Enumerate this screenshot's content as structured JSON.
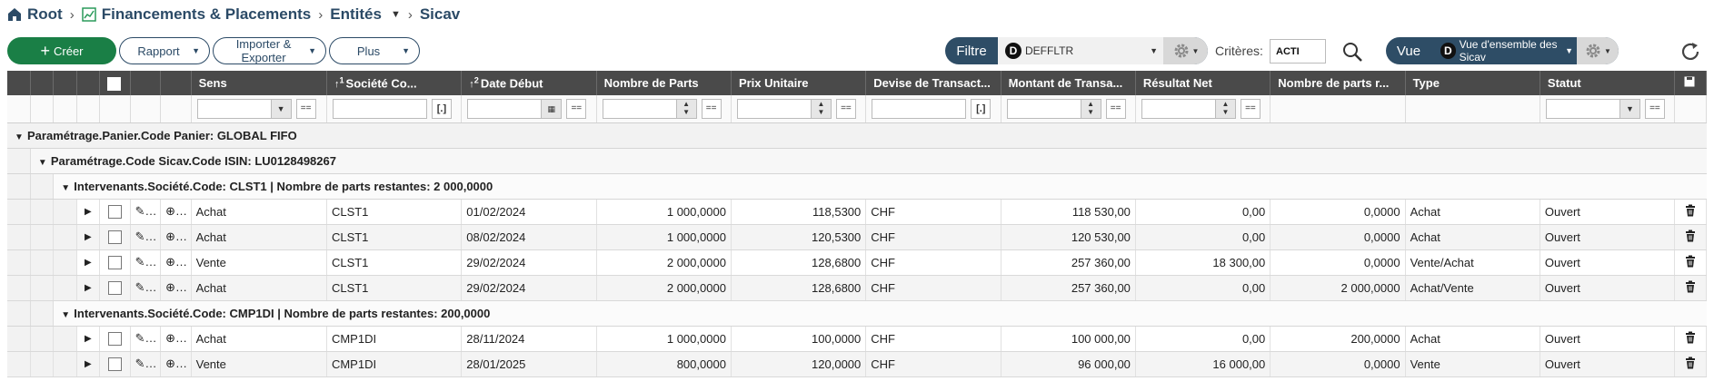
{
  "breadcrumb": {
    "root": "Root",
    "level2": "Financements & Placements",
    "level3": "Entités",
    "level4": "Sicav"
  },
  "toolbar": {
    "create_label": "Créer",
    "rapport_label": "Rapport",
    "import_export_label": "Importer & Exporter",
    "plus_label": "Plus"
  },
  "filter": {
    "label": "Filtre",
    "badge": "D",
    "value": "DEFFLTR",
    "criteres_label": "Critères:",
    "criteres_value": "ACTI"
  },
  "view": {
    "label": "Vue",
    "badge": "D",
    "value": "Vue d'ensemble des Sicav"
  },
  "columns": {
    "sens": "Sens",
    "societe": "Société Co...",
    "societe_sort": "1",
    "date": "Date Début",
    "date_sort": "2",
    "nb_parts": "Nombre de Parts",
    "prix": "Prix Unitaire",
    "devise": "Devise de Transact...",
    "montant": "Montant de Transa...",
    "resultat": "Résultat Net",
    "parts_restantes": "Nombre de parts r...",
    "type": "Type",
    "statut": "Statut"
  },
  "filters_row": {
    "op_equals": "==",
    "op_bracket": "[.]"
  },
  "groups": {
    "panier": "Paramétrage.Panier.Code Panier: GLOBAL FIFO",
    "sicav": "Paramétrage.Code Sicav.Code ISIN: LU0128498267",
    "soc1": "Intervenants.Société.Code: CLST1 | Nombre de parts restantes: 2 000,0000",
    "soc2": "Intervenants.Société.Code: CMP1DI | Nombre de parts restantes: 200,0000"
  },
  "rows_clst1": [
    {
      "sens": "Achat",
      "societe": "CLST1",
      "date": "01/02/2024",
      "nb_parts": "1 000,0000",
      "prix": "118,5300",
      "devise": "CHF",
      "montant": "118 530,00",
      "resultat": "0,00",
      "restantes": "0,0000",
      "type": "Achat",
      "statut": "Ouvert"
    },
    {
      "sens": "Achat",
      "societe": "CLST1",
      "date": "08/02/2024",
      "nb_parts": "1 000,0000",
      "prix": "120,5300",
      "devise": "CHF",
      "montant": "120 530,00",
      "resultat": "0,00",
      "restantes": "0,0000",
      "type": "Achat",
      "statut": "Ouvert"
    },
    {
      "sens": "Vente",
      "societe": "CLST1",
      "date": "29/02/2024",
      "nb_parts": "2 000,0000",
      "prix": "128,6800",
      "devise": "CHF",
      "montant": "257 360,00",
      "resultat": "18 300,00",
      "restantes": "0,0000",
      "type": "Vente/Achat",
      "statut": "Ouvert"
    },
    {
      "sens": "Achat",
      "societe": "CLST1",
      "date": "29/02/2024",
      "nb_parts": "2 000,0000",
      "prix": "128,6800",
      "devise": "CHF",
      "montant": "257 360,00",
      "resultat": "0,00",
      "restantes": "2 000,0000",
      "type": "Achat/Vente",
      "statut": "Ouvert"
    }
  ],
  "rows_cmp1di": [
    {
      "sens": "Achat",
      "societe": "CMP1DI",
      "date": "28/11/2024",
      "nb_parts": "1 000,0000",
      "prix": "100,0000",
      "devise": "CHF",
      "montant": "100 000,00",
      "resultat": "0,00",
      "restantes": "200,0000",
      "type": "Achat",
      "statut": "Ouvert"
    },
    {
      "sens": "Vente",
      "societe": "CMP1DI",
      "date": "28/01/2025",
      "nb_parts": "800,0000",
      "prix": "120,0000",
      "devise": "CHF",
      "montant": "96 000,00",
      "resultat": "16 000,00",
      "restantes": "0,0000",
      "type": "Vente",
      "statut": "Ouvert"
    }
  ],
  "icons": {
    "edit": "pencil-icon",
    "view": "zoom-icon",
    "delete": "trash-icon",
    "expand": "expand-triangle-icon"
  }
}
